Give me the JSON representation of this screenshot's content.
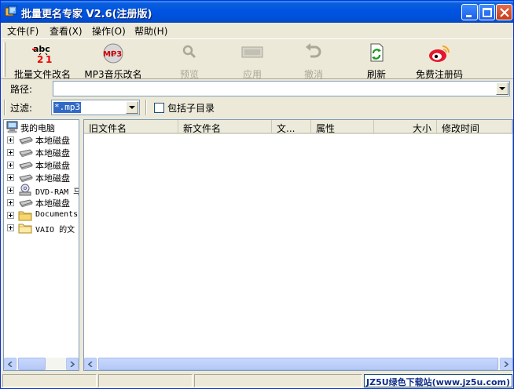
{
  "window": {
    "title": "批量更名专家 V2.6(注册版)"
  },
  "menu": [
    {
      "label": "文件(F)"
    },
    {
      "label": "查看(X)"
    },
    {
      "label": "操作(O)"
    },
    {
      "label": "帮助(H)"
    }
  ],
  "toolbar": {
    "batch_rename": "批量文件改名",
    "mp3_rename": "MP3音乐改名",
    "preview": "预览",
    "apply": "应用",
    "undo": "撤消",
    "refresh": "刷新",
    "register": "免费注册码"
  },
  "path": {
    "label": "路径:",
    "value": ""
  },
  "filter": {
    "label": "过滤:",
    "value": "*.mp3",
    "subdirs_label": "包括子目录",
    "subdirs_checked": false
  },
  "tree": {
    "root": "我的电脑",
    "items": [
      {
        "label": "本地磁盘",
        "icon": "drive-icon"
      },
      {
        "label": "本地磁盘",
        "icon": "drive-icon"
      },
      {
        "label": "本地磁盘",
        "icon": "drive-icon"
      },
      {
        "label": "本地磁盘",
        "icon": "drive-icon"
      },
      {
        "label": "DVD-RAM 马",
        "icon": "dvd-drive-icon"
      },
      {
        "label": "本地磁盘",
        "icon": "drive-icon"
      },
      {
        "label": "Documents",
        "icon": "folder-icon"
      },
      {
        "label": "VAIO 的文",
        "icon": "folder-icon"
      }
    ]
  },
  "columns": [
    {
      "label": "旧文件名"
    },
    {
      "label": "新文件名"
    },
    {
      "label": "文..."
    },
    {
      "label": "属性"
    },
    {
      "label": "大小"
    },
    {
      "label": "修改时间"
    }
  ],
  "status": {
    "watermark": "JZ5U绿色下载站(www.jz5u.com)"
  }
}
